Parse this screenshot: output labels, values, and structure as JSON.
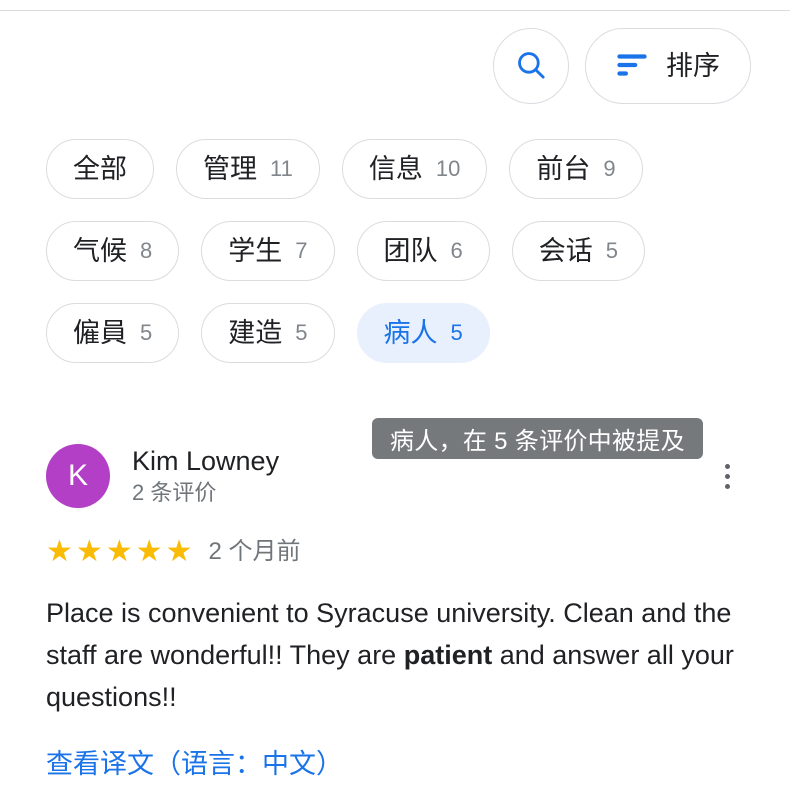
{
  "header": {
    "search_icon": "search-icon",
    "sort_icon": "sort-lines-icon",
    "sort_label": "排序"
  },
  "filters": {
    "chips": [
      {
        "label": "全部",
        "count": ""
      },
      {
        "label": "管理",
        "count": "11"
      },
      {
        "label": "信息",
        "count": "10"
      },
      {
        "label": "前台",
        "count": "9"
      },
      {
        "label": "气候",
        "count": "8"
      },
      {
        "label": "学生",
        "count": "7"
      },
      {
        "label": "团队",
        "count": "6"
      },
      {
        "label": "会话",
        "count": "5"
      },
      {
        "label": "僱員",
        "count": "5"
      },
      {
        "label": "建造",
        "count": "5"
      },
      {
        "label": "病人",
        "count": "5",
        "selected": true
      }
    ]
  },
  "tooltip": {
    "text": "病人，在 5 条评价中被提及"
  },
  "review": {
    "avatar_initial": "K",
    "avatar_color": "#b33fc6",
    "author": "Kim Lowney",
    "author_reviews": "2 条评价",
    "rating": 5,
    "star_glyph": "★",
    "star_color": "#fabb05",
    "time_ago": "2 个月前",
    "text_part1": "Place is convenient to Syracuse university. Clean and the staff are wonderful!! They are ",
    "text_highlight": "patient",
    "text_part2": " and answer all your questions!!",
    "translate_label": "查看译文（语言：中文）",
    "menu_icon": "more-vertical-icon"
  },
  "colors": {
    "accent_blue": "#1a73e8",
    "chip_selected_bg": "#e8f0fe",
    "tooltip_bg": "#75797c",
    "border": "#dadce0"
  }
}
